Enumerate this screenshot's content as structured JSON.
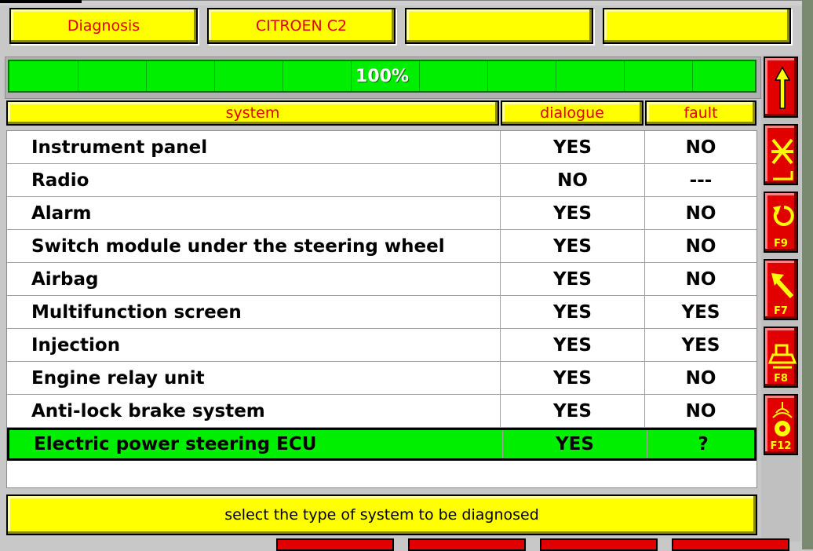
{
  "tabs": [
    "Diagnosis",
    "CITROEN C2",
    "",
    ""
  ],
  "progress": {
    "value": 100,
    "label": "100%"
  },
  "columns": {
    "system": "system",
    "dialogue": "dialogue",
    "fault": "fault"
  },
  "rows": [
    {
      "system": "Instrument panel",
      "dialogue": "YES",
      "fault": "NO"
    },
    {
      "system": "Radio",
      "dialogue": "NO",
      "fault": "---"
    },
    {
      "system": "Alarm",
      "dialogue": "YES",
      "fault": "NO"
    },
    {
      "system": "Switch module under the steering wheel",
      "dialogue": "YES",
      "fault": "NO"
    },
    {
      "system": "Airbag",
      "dialogue": "YES",
      "fault": "NO"
    },
    {
      "system": "Multifunction screen",
      "dialogue": "YES",
      "fault": "YES"
    },
    {
      "system": "Injection",
      "dialogue": "YES",
      "fault": "YES"
    },
    {
      "system": "Engine relay unit",
      "dialogue": "YES",
      "fault": "NO"
    },
    {
      "system": "Anti-lock brake system",
      "dialogue": "YES",
      "fault": "NO"
    },
    {
      "system": "Electric power steering ECU",
      "dialogue": "YES",
      "fault": "?"
    }
  ],
  "selected_row": 9,
  "status_message": "select the type of system to be diagnosed",
  "side_buttons": [
    {
      "icon": "up-arrow-icon",
      "key": ""
    },
    {
      "icon": "cancel-enter-icon",
      "key": ""
    },
    {
      "icon": "refresh-icon",
      "key": "F9"
    },
    {
      "icon": "back-arrow-icon",
      "key": "F7"
    },
    {
      "icon": "print-icon",
      "key": "F8"
    },
    {
      "icon": "help-icon",
      "key": "F12"
    }
  ],
  "colors": {
    "tab_bg": "#ffff00",
    "tab_text": "#e00000",
    "progress": "#00ee00",
    "selected_row": "#00ee00",
    "side_button": "#e00000"
  }
}
